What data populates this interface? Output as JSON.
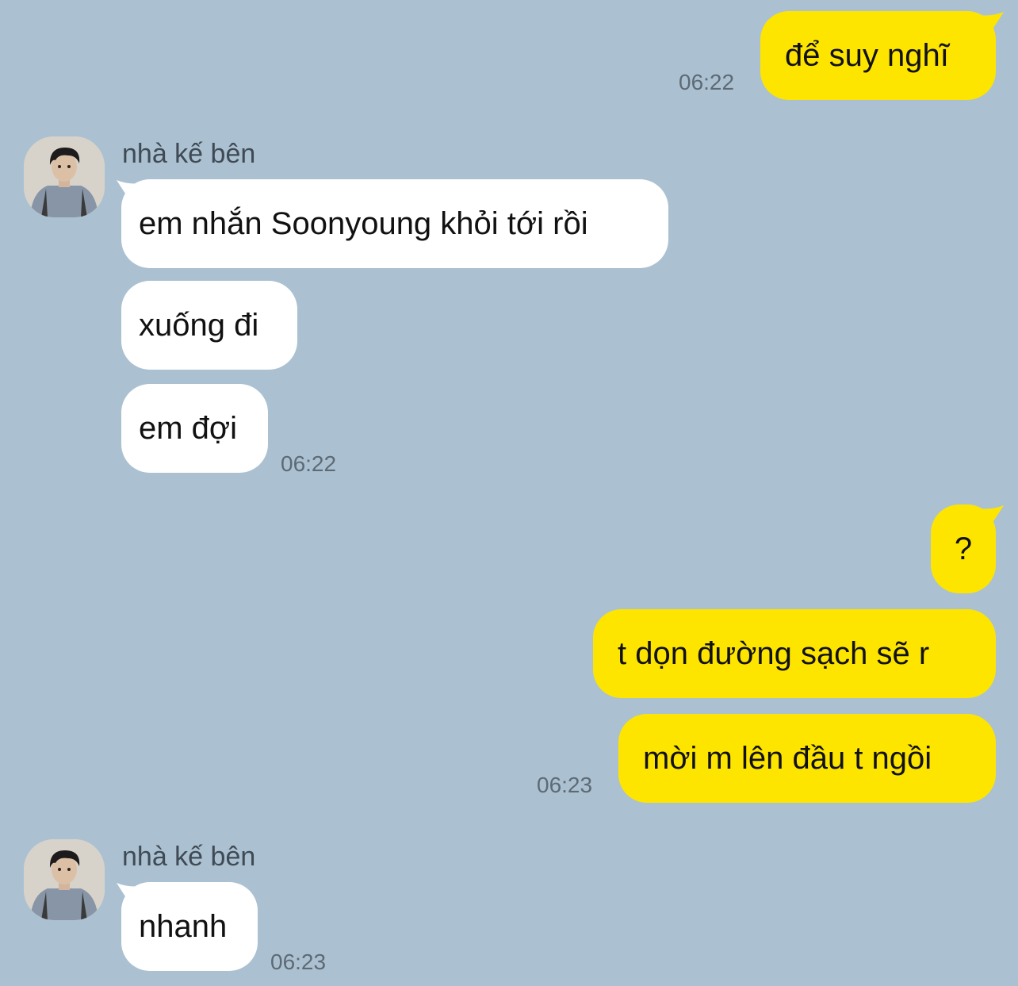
{
  "colors": {
    "background": "#abc1d1",
    "incoming_bubble": "#ffffff",
    "outgoing_bubble": "#fee500",
    "timestamp": "#5d6a75",
    "sender_name": "#3f4a54"
  },
  "messages": {
    "m1": {
      "text": "để suy nghĩ",
      "time": "06:22"
    },
    "g1": {
      "sender": "nhà kế bên",
      "avatar_icon": "profile-photo-avatar",
      "b1": "em nhắn Soonyoung khỏi tới rồi",
      "b2": "xuống đi",
      "b3": "em đợi",
      "time": "06:22"
    },
    "g2": {
      "b1": "?",
      "b2": "t dọn đường sạch sẽ r",
      "b3": "mời m lên đầu t ngồi",
      "time": "06:23"
    },
    "g3": {
      "sender": "nhà kế bên",
      "avatar_icon": "profile-photo-avatar",
      "b1": "nhanh",
      "time": "06:23"
    }
  }
}
